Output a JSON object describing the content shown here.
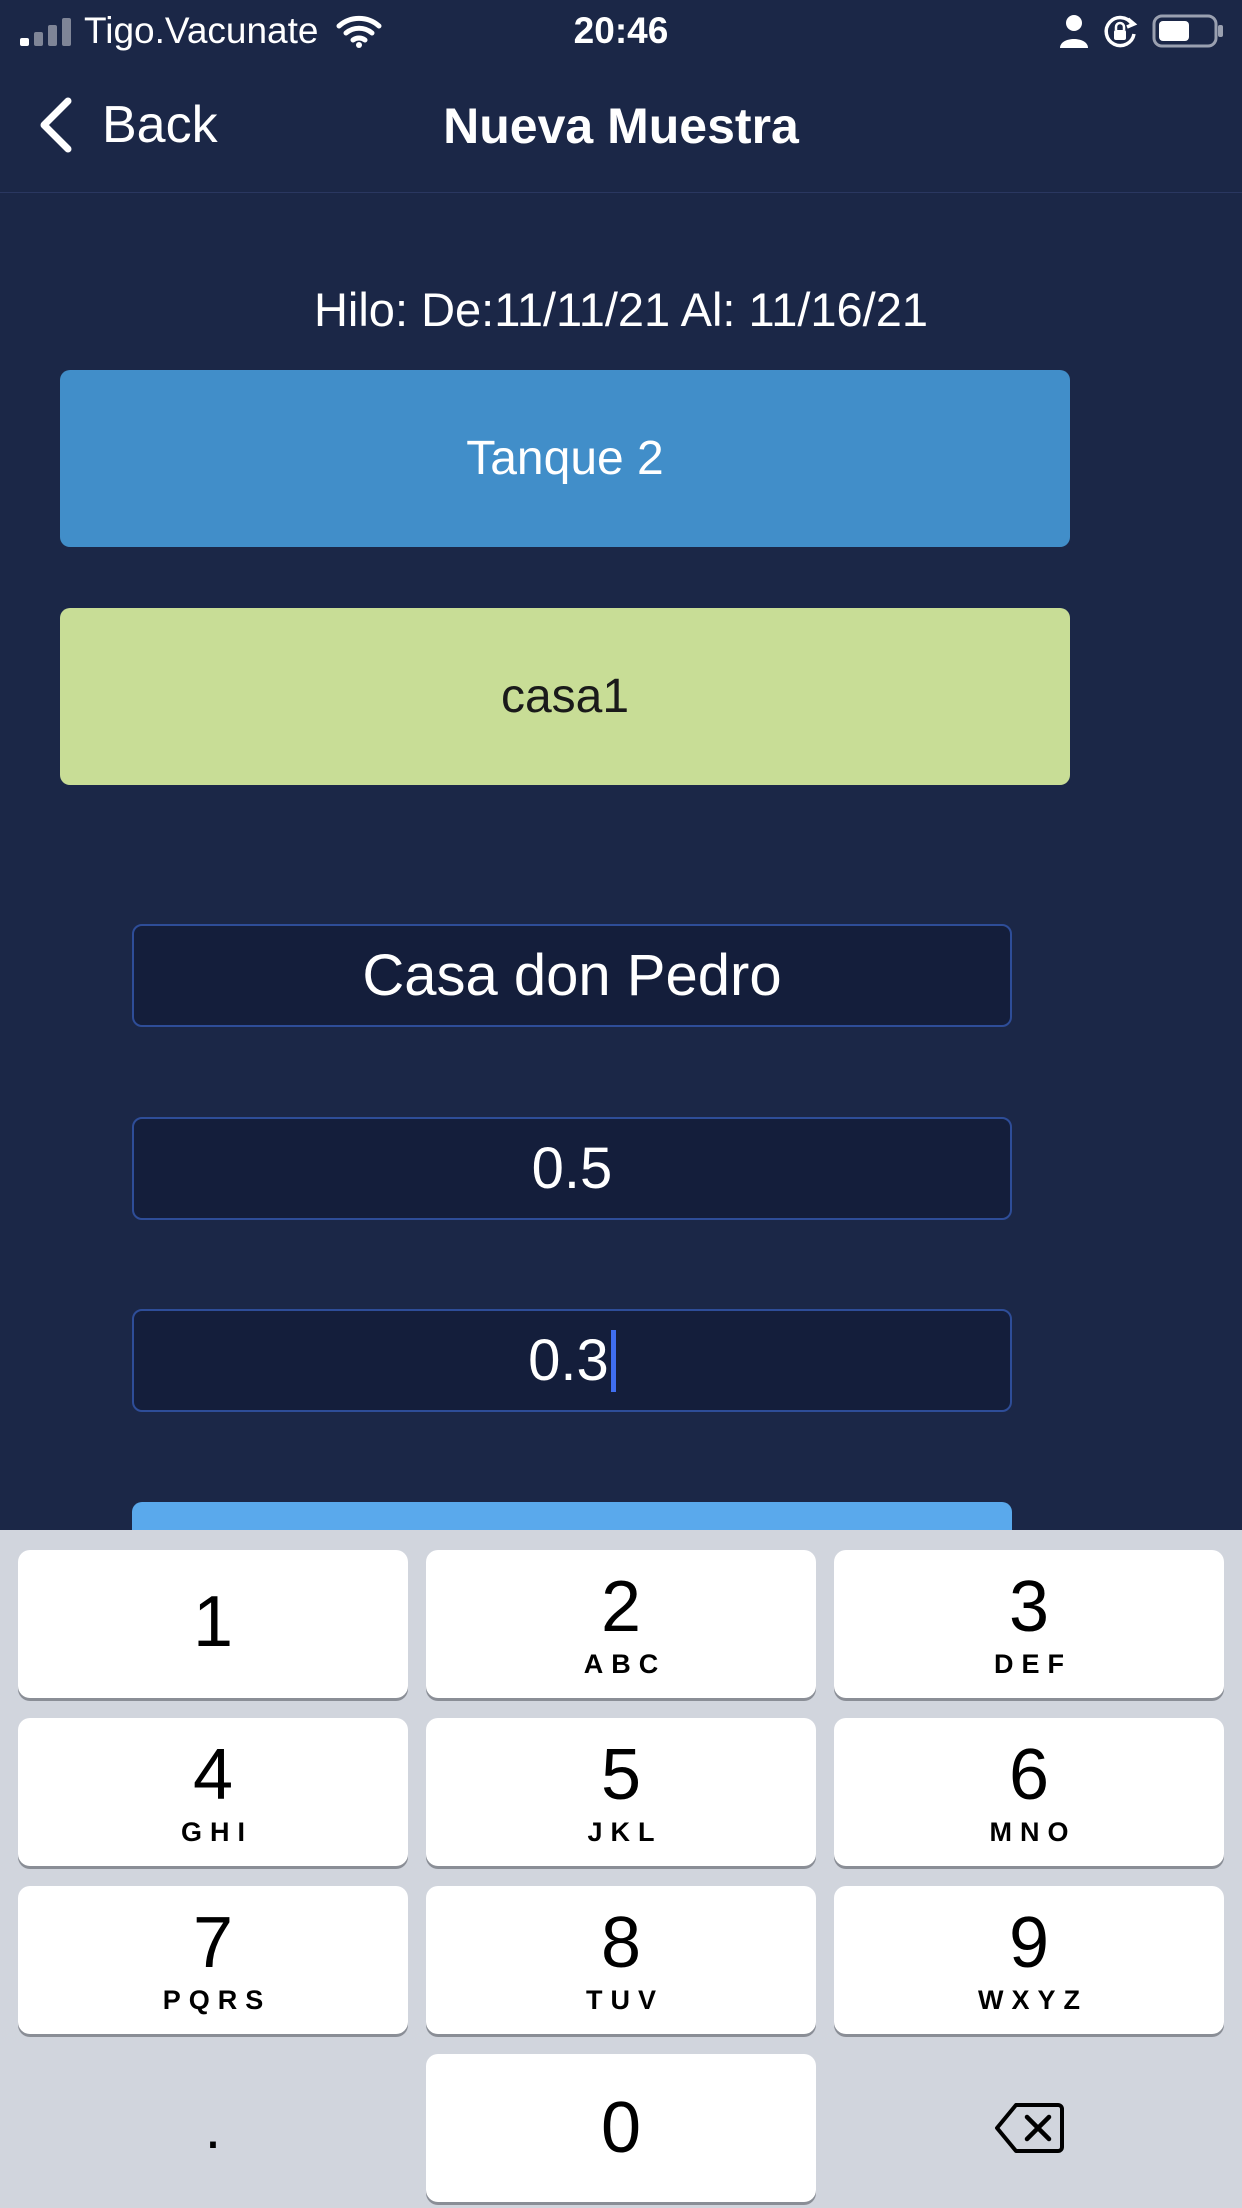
{
  "status_bar": {
    "carrier": "Tigo.Vacunate",
    "time": "20:46",
    "icons": [
      "signal-icon",
      "wifi-icon",
      "person-icon",
      "orientation-lock-icon",
      "battery-icon"
    ]
  },
  "nav": {
    "back_label": "Back",
    "title": "Nueva Muestra"
  },
  "hilo_text": "Hilo: De:11/11/21 Al: 11/16/21",
  "tank_button": {
    "label": "Tanque 2",
    "color": "#418ec9"
  },
  "house_button": {
    "label": "casa1",
    "color": "#c8dd96"
  },
  "fields": {
    "name": "Casa don Pedro",
    "value1": "0.5",
    "value2": "0.3"
  },
  "colors": {
    "background": "#1b2747",
    "accent": "#5aa9ec",
    "field_border": "#2e4d98",
    "caret": "#3f6ef0"
  },
  "keyboard": {
    "keys": [
      {
        "num": "1",
        "letters": ""
      },
      {
        "num": "2",
        "letters": "ABC"
      },
      {
        "num": "3",
        "letters": "DEF"
      },
      {
        "num": "4",
        "letters": "GHI"
      },
      {
        "num": "5",
        "letters": "JKL"
      },
      {
        "num": "6",
        "letters": "MNO"
      },
      {
        "num": "7",
        "letters": "PQRS"
      },
      {
        "num": "8",
        "letters": "TUV"
      },
      {
        "num": "9",
        "letters": "WXYZ"
      },
      {
        "num": "0",
        "letters": ""
      }
    ],
    "decimal": ".",
    "delete_icon": "backspace-icon"
  }
}
